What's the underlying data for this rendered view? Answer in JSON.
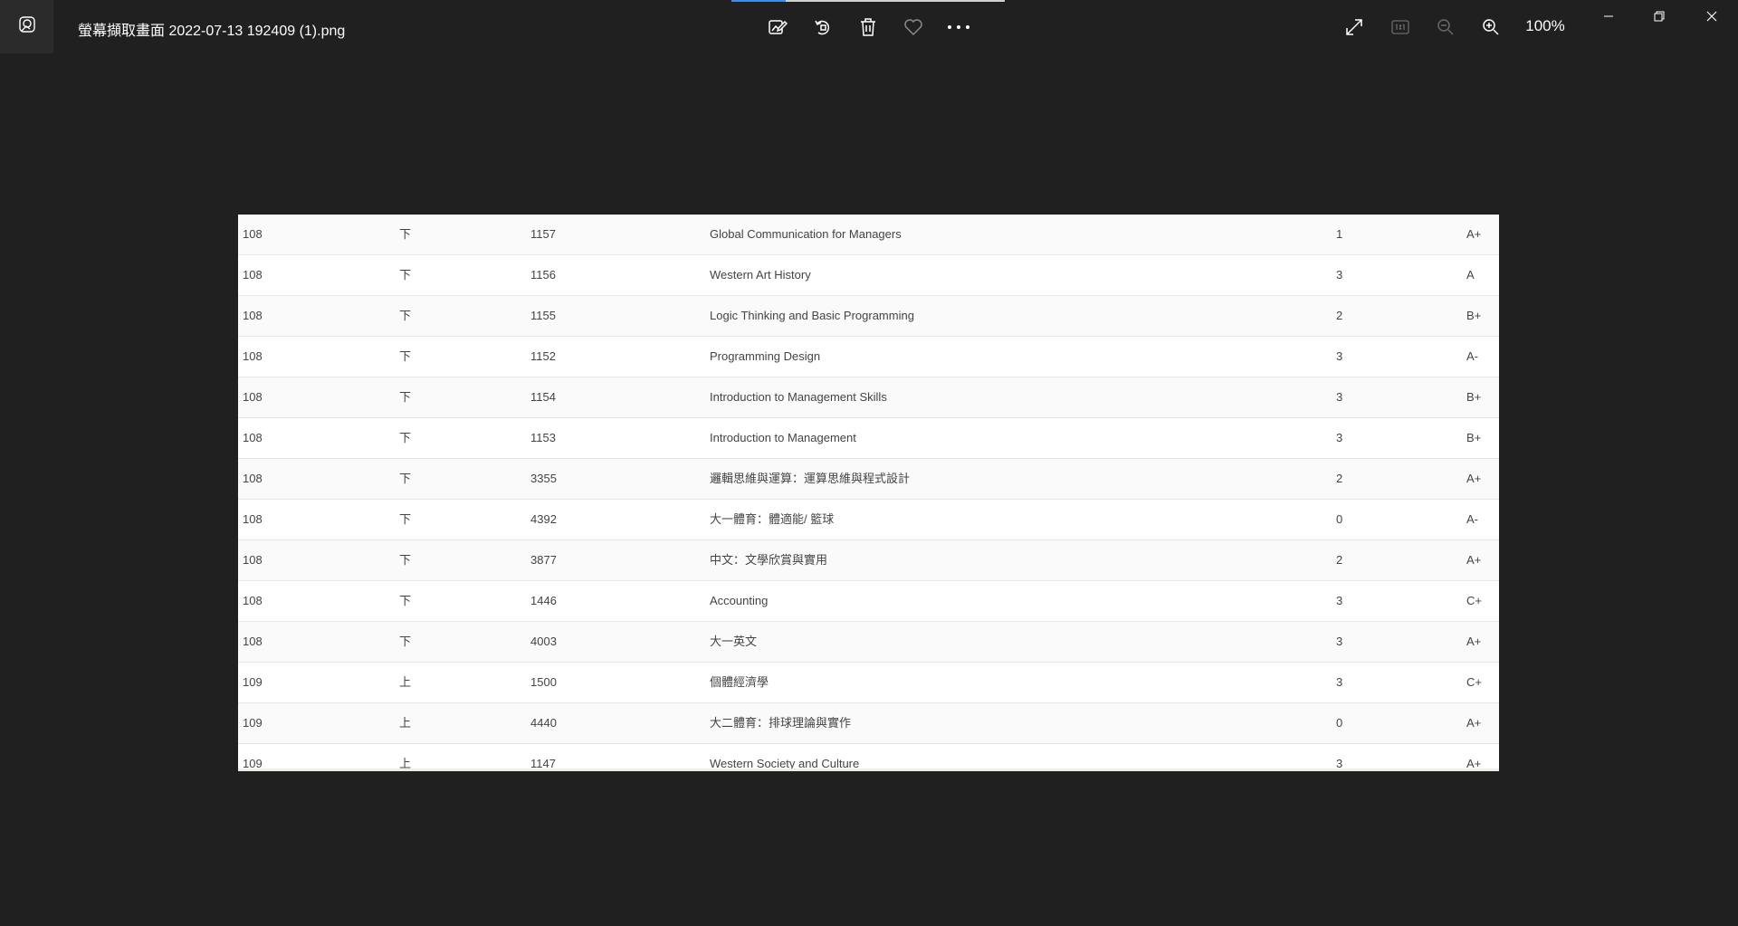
{
  "window": {
    "title": "螢幕擷取畫面 2022-07-13 192409 (1).png",
    "zoom": "100%",
    "accent_color": "#3a8ee6"
  },
  "toolbar": {
    "icons": [
      "edit-image-icon",
      "rotate-icon",
      "delete-icon",
      "favorite-icon",
      "more-icon"
    ],
    "right_icons": [
      "full-screen-icon",
      "actual-size-icon",
      "zoom-out-icon",
      "zoom-in-icon"
    ]
  },
  "grades": {
    "rows": [
      {
        "year": "108",
        "term": "下",
        "code": "1157",
        "name": "Global Communication for Managers",
        "credit": "1",
        "grade": "A+"
      },
      {
        "year": "108",
        "term": "下",
        "code": "1156",
        "name": "Western Art History",
        "credit": "3",
        "grade": "A"
      },
      {
        "year": "108",
        "term": "下",
        "code": "1155",
        "name": "Logic Thinking and Basic Programming",
        "credit": "2",
        "grade": "B+"
      },
      {
        "year": "108",
        "term": "下",
        "code": "1152",
        "name": "Programming Design",
        "credit": "3",
        "grade": "A-"
      },
      {
        "year": "108",
        "term": "下",
        "code": "1154",
        "name": "Introduction to Management Skills",
        "credit": "3",
        "grade": "B+"
      },
      {
        "year": "108",
        "term": "下",
        "code": "1153",
        "name": "Introduction to Management",
        "credit": "3",
        "grade": "B+"
      },
      {
        "year": "108",
        "term": "下",
        "code": "3355",
        "name": "邏輯思維與運算：運算思維與程式設計",
        "credit": "2",
        "grade": "A+"
      },
      {
        "year": "108",
        "term": "下",
        "code": "4392",
        "name": "大一體育：體適能/ 籃球",
        "credit": "0",
        "grade": "A-"
      },
      {
        "year": "108",
        "term": "下",
        "code": "3877",
        "name": "中文：文學欣賞與實用",
        "credit": "2",
        "grade": "A+"
      },
      {
        "year": "108",
        "term": "下",
        "code": "1446",
        "name": "Accounting",
        "credit": "3",
        "grade": "C+"
      },
      {
        "year": "108",
        "term": "下",
        "code": "4003",
        "name": "大一英文",
        "credit": "3",
        "grade": "A+"
      },
      {
        "year": "109",
        "term": "上",
        "code": "1500",
        "name": "個體經濟學",
        "credit": "3",
        "grade": "C+"
      },
      {
        "year": "109",
        "term": "上",
        "code": "4440",
        "name": "大二體育：排球理論與實作",
        "credit": "0",
        "grade": "A+"
      },
      {
        "year": "109",
        "term": "上",
        "code": "1147",
        "name": "Western Society and Culture",
        "credit": "3",
        "grade": "A+"
      }
    ]
  }
}
